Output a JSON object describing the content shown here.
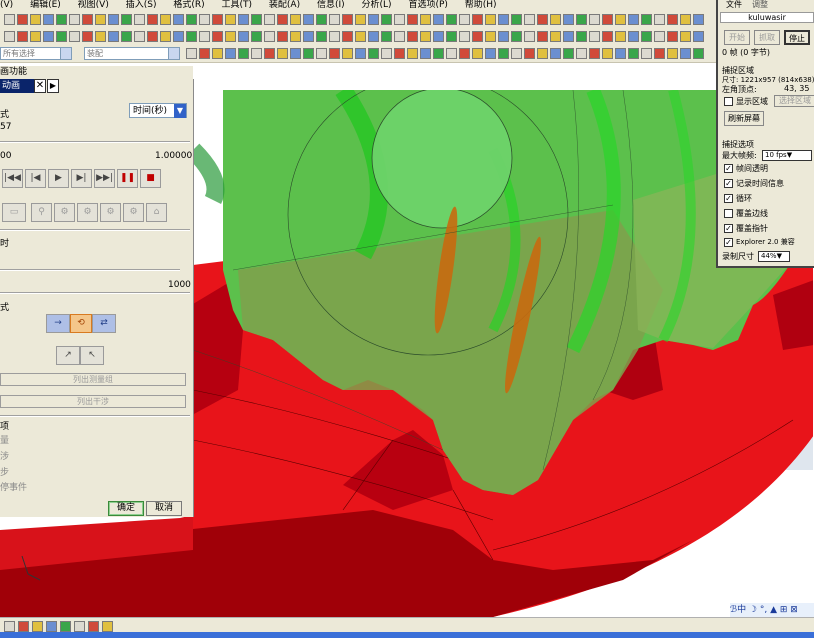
{
  "menu": [
    "(V)",
    "编辑(E)",
    "视图(V)",
    "插入(S)",
    "格式(R)",
    "工具(T)",
    "装配(A)",
    "信息(I)",
    "分析(L)",
    "首选项(P)",
    "帮助(H)"
  ],
  "toolbar_dropdowns": {
    "dd1": "所有选择",
    "dd2": "装配"
  },
  "panel": {
    "header_title": "画功能",
    "tab_label": "动画",
    "mode_label": "式",
    "mode_value": "时间(秒)",
    "value_57": "57",
    "range_start": "00",
    "range_end": "1.00000",
    "time_label": "时",
    "slider_max": "1000",
    "mode2_label": "式",
    "list_btn1": "列出测量组",
    "list_btn2": "列出干涉",
    "options_label": "项",
    "opt1": "量",
    "opt2": "涉",
    "opt3": "步",
    "opt4": "停事件",
    "ok_label": "确定",
    "cancel_label": "取消"
  },
  "capture": {
    "menu_file": "文件",
    "menu_debug": "调整",
    "app_name": "kuluwasir",
    "btn_start": "开始",
    "btn_grab": "抓取",
    "btn_stop": "停止",
    "status": "0 帧 (0 字节)",
    "region_title": "捕捉区域",
    "size_line": "尺寸: 1221x957 (814x638)",
    "corner_label": "左角顶点:",
    "corner_value": "43, 35",
    "show_region": "显示区域",
    "select_region": "选择区域",
    "refresh_screen": "刷新屏幕",
    "options_title": "捕捉选项",
    "max_fps_label": "最大帧频:",
    "max_fps_value": "10 fps",
    "opt_transparent": "帧间透明",
    "opt_timing": "记录时间信息",
    "opt_loop": "循环",
    "opt_border": "覆盖边线",
    "opt_cursor": "覆盖指针",
    "opt_ie": "Explorer 2.0 兼容",
    "record_size_label": "录制尺寸",
    "record_size_value": "44%",
    "checks": {
      "transparent": true,
      "timing": true,
      "loop": true,
      "border": false,
      "cursor": true,
      "ie": true,
      "show_region": false
    }
  },
  "ime": {
    "text": "ℬ中 ☽ °, ▲ ⊞ ⊠"
  },
  "colors": {
    "gear_green": "#5cc04c",
    "rack_red": "#e8141a",
    "rack_dark": "#a00008",
    "panel_bg": "#ece9d8",
    "ok_green": "#3a8a3a"
  }
}
